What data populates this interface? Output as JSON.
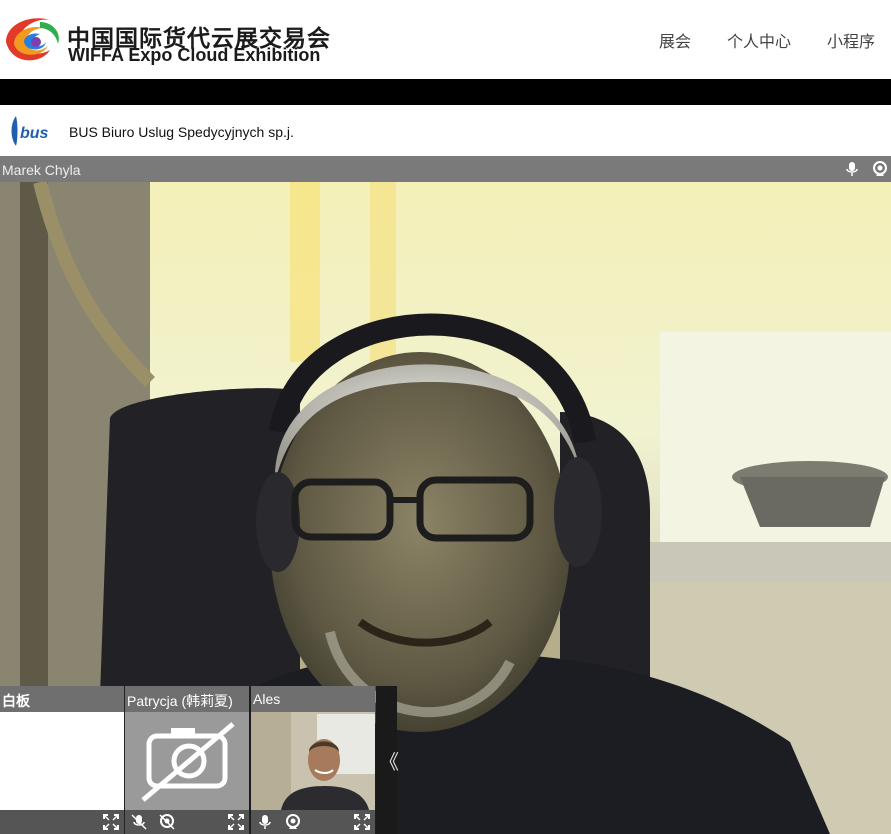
{
  "header": {
    "logo_cn": "中国国际货代云展交易会",
    "logo_en": "WIFFA Expo Cloud Exhibition",
    "nav": [
      "展会",
      "个人中心",
      "小程序"
    ]
  },
  "company": {
    "logo_text": "bus",
    "name": "BUS Biuro Uslug Spedycyjnych sp.j."
  },
  "main_video": {
    "participant": "Marek Chyla"
  },
  "thumbnails": {
    "whiteboard": "白板",
    "participant_2": "Patrycja (韩莉夏)",
    "participant_3": "Ales",
    "collapse_glyph": "《"
  }
}
